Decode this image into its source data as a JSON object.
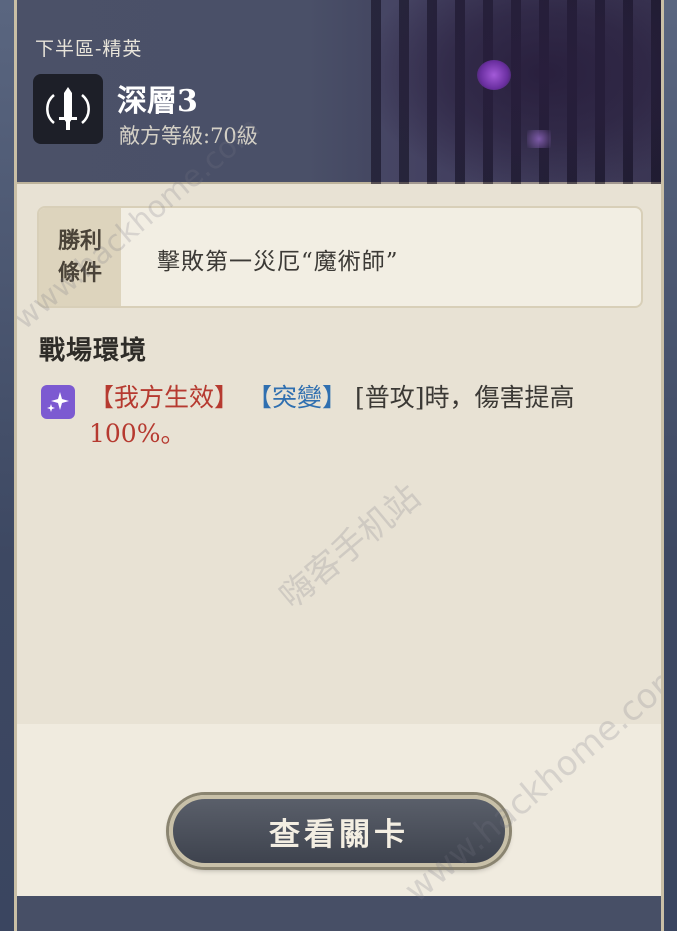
{
  "header": {
    "section_label": "下半區-精英",
    "stage_title": "深層3",
    "enemy_level": "敵方等級:70級",
    "stage_icon": "sword-shield-icon"
  },
  "victory": {
    "tag_line1": "勝利",
    "tag_line2": "條件",
    "text": "擊敗第一災厄“魔術師”"
  },
  "environment": {
    "title": "戰場環境",
    "icon": "sparkle-icon",
    "tag_own": "【我方生效】",
    "tag_mutation": "【突變】",
    "body": "[普攻]時，傷害提高",
    "value": "100%。"
  },
  "button": {
    "label": "查看關卡"
  },
  "watermarks": {
    "side": "www.hackhome.com",
    "cn": "嗨客手机站",
    "lower": "www.hackhome.com"
  },
  "colors": {
    "accent_red": "#b63a30",
    "accent_blue": "#2f6fb0",
    "env_icon_bg": "#7c5ad1"
  }
}
